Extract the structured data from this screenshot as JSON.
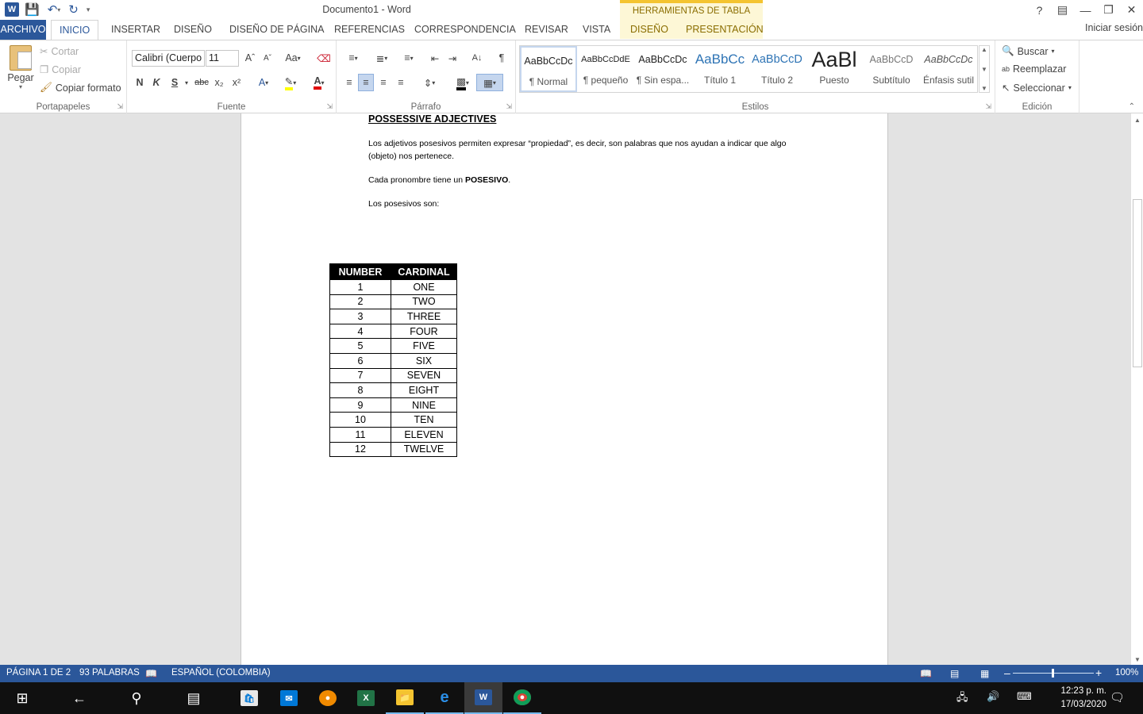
{
  "window": {
    "title": "Documento1 - Word",
    "context_tab_header": "HERRAMIENTAS DE TABLA",
    "sign_in": "Iniciar sesión"
  },
  "tabs": [
    "ARCHIVO",
    "INICIO",
    "INSERTAR",
    "DISEÑO",
    "DISEÑO DE PÁGINA",
    "REFERENCIAS",
    "CORRESPONDENCIA",
    "REVISAR",
    "VISTA",
    "DISEÑO",
    "PRESENTACIÓN"
  ],
  "ribbon": {
    "clipboard": {
      "paste": "Pegar",
      "cut": "Cortar",
      "copy": "Copiar",
      "format_painter": "Copiar formato",
      "label": "Portapapeles"
    },
    "font": {
      "family": "Calibri (Cuerpo",
      "size": "11",
      "label": "Fuente",
      "bold": "N",
      "italic": "K",
      "underline": "S",
      "change_case": "Aa"
    },
    "paragraph": {
      "label": "Párrafo"
    },
    "styles": {
      "label": "Estilos",
      "items": [
        {
          "preview": "AaBbCcDc",
          "name": "¶ Normal"
        },
        {
          "preview": "AaBbCcDdE",
          "name": "¶ pequeño"
        },
        {
          "preview": "AaBbCcDc",
          "name": "¶ Sin espa..."
        },
        {
          "preview": "AaBbCc",
          "name": "Título 1"
        },
        {
          "preview": "AaBbCcD",
          "name": "Título 2"
        },
        {
          "preview": "AaBl",
          "name": "Puesto"
        },
        {
          "preview": "AaBbCcD",
          "name": "Subtítulo"
        },
        {
          "preview": "AaBbCcDc",
          "name": "Énfasis sutil"
        }
      ]
    },
    "editing": {
      "find": "Buscar",
      "replace": "Reemplazar",
      "select": "Seleccionar",
      "label": "Edición"
    }
  },
  "document": {
    "heading": "POSSESSIVE ADJECTIVES",
    "para1": "Los adjetivos posesivos permiten expresar “propiedad”, es decir, son palabras que nos ayudan a indicar que algo (objeto) nos pertenece.",
    "para2_prefix": "Cada pronombre tiene un ",
    "para2_bold": "POSESIVO",
    "para2_suffix": ".",
    "para3": "Los posesivos son:",
    "table": {
      "headers": [
        "NUMBER",
        "CARDINAL"
      ],
      "rows": [
        [
          "1",
          "ONE"
        ],
        [
          "2",
          "TWO"
        ],
        [
          "3",
          "THREE"
        ],
        [
          "4",
          "FOUR"
        ],
        [
          "5",
          "FIVE"
        ],
        [
          "6",
          "SIX"
        ],
        [
          "7",
          "SEVEN"
        ],
        [
          "8",
          "EIGHT"
        ],
        [
          "9",
          "NINE"
        ],
        [
          "10",
          "TEN"
        ],
        [
          "11",
          "ELEVEN"
        ],
        [
          "12",
          "TWELVE"
        ]
      ]
    }
  },
  "status": {
    "page": "PÁGINA 1 DE 2",
    "words": "93 PALABRAS",
    "language": "ESPAÑOL (COLOMBIA)",
    "zoom": "100%"
  },
  "taskbar": {
    "time": "12:23 p. m.",
    "date": "17/03/2020"
  }
}
